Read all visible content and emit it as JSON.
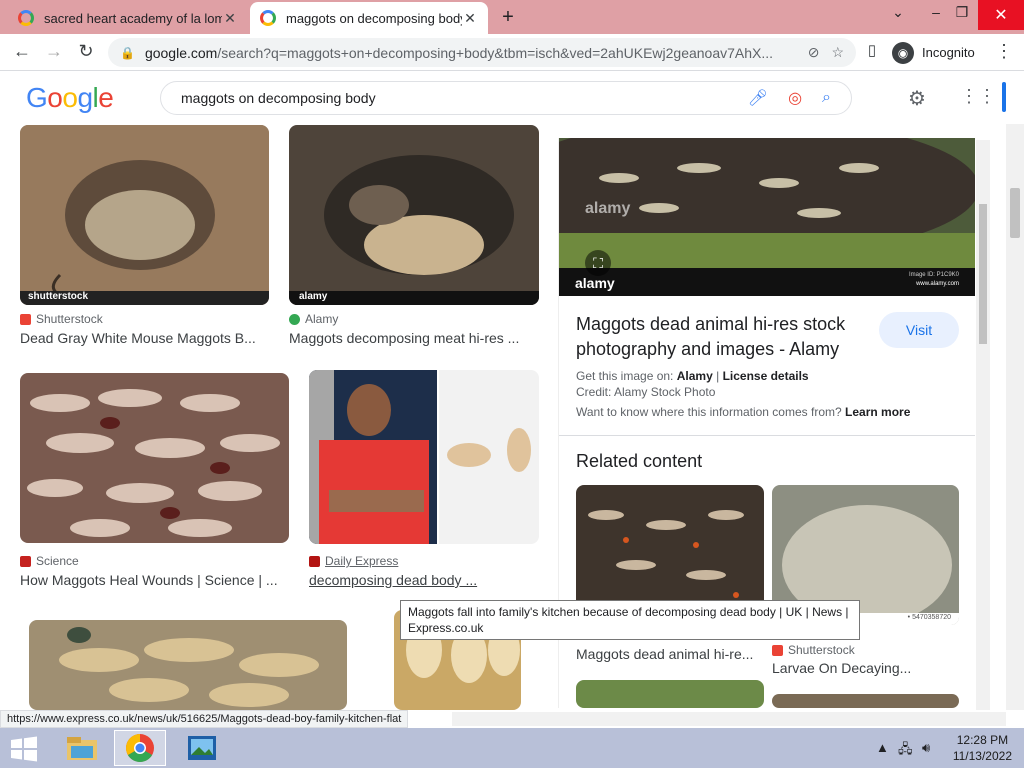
{
  "browser": {
    "tabs": [
      {
        "label": "sacred heart academy of la loma",
        "active": false
      },
      {
        "label": "maggots on decomposing body",
        "active": true
      }
    ],
    "url_host": "google.com",
    "url_path": "/search?q=maggots+on+decomposing+body&tbm=isch&ved=2ahUKEwj2geanoav7AhX...",
    "profile_label": "Incognito"
  },
  "google": {
    "logo_letters": [
      "G",
      "o",
      "o",
      "g",
      "l",
      "e"
    ],
    "query": "maggots on decomposing body"
  },
  "results": [
    {
      "source": "Shutterstock",
      "title": "Dead Gray White Mouse Maggots B...",
      "watermark": "shutterstock",
      "fav_color": "#ea4335"
    },
    {
      "source": "Alamy",
      "title": "Maggots decomposing meat hi-res ...",
      "watermark": "alamy",
      "fav_color": "#34a853"
    },
    {
      "source": "Science",
      "title": "How Maggots Heal Wounds | Science | ...",
      "fav_color": "#c5221f"
    },
    {
      "source": "Daily Express",
      "title": "decomposing dead body ...",
      "fav_color": "#b31412"
    }
  ],
  "panel": {
    "watermark": "alamy",
    "caption": "alamy",
    "image_id": "Image ID: P1C9K0",
    "image_site": "www.alamy.com",
    "title": "Maggots dead animal hi-res stock photography and images - Alamy",
    "visit_label": "Visit",
    "get_image_prefix": "Get this image on:",
    "get_image_source": "Alamy",
    "license_label": "License details",
    "credit": "Credit: Alamy Stock Photo",
    "want_to_know": "Want to know where this information comes from?",
    "learn_more": "Learn more",
    "related_heading": "Related content",
    "related": [
      {
        "source": "",
        "title": "Maggots dead animal hi-re..."
      },
      {
        "source": "Shutterstock",
        "title": "Larvae On Decaying..."
      }
    ],
    "related_image_id": "• 5470358720"
  },
  "tooltip": "Maggots fall into family's kitchen because of decomposing dead body | UK |  News | Express.co.uk",
  "status_url": "https://www.express.co.uk/news/uk/516625/Maggots-dead-boy-family-kitchen-flat",
  "taskbar": {
    "time": "12:28 PM",
    "date": "11/13/2022"
  },
  "colors": {
    "titlebar": "#dfa0a5",
    "accent": "#1a73e8",
    "taskbar": "#b8c0d8"
  }
}
